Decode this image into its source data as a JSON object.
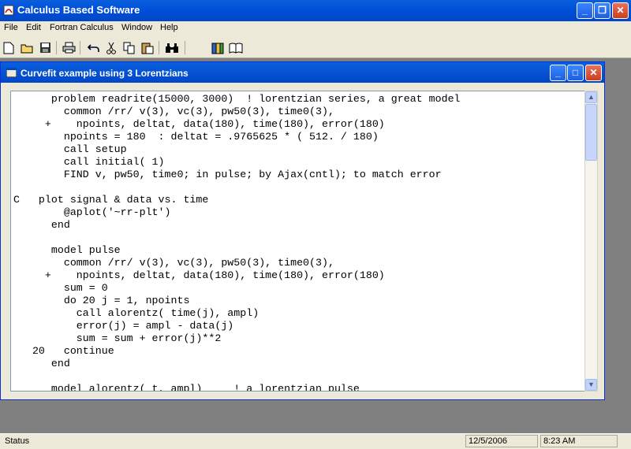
{
  "app": {
    "title": "Calculus Based Software",
    "icon": "app-logo-icon"
  },
  "menu": {
    "items": [
      "File",
      "Edit",
      "Fortran Calculus",
      "Window",
      "Help"
    ]
  },
  "toolbar": {
    "buttons": [
      {
        "icon": "new-document-icon"
      },
      {
        "icon": "open-folder-icon"
      },
      {
        "icon": "save-icon"
      },
      {
        "icon": "print-icon"
      },
      {
        "icon": "undo-icon"
      },
      {
        "icon": "cut-icon"
      },
      {
        "icon": "copy-icon"
      },
      {
        "icon": "paste-icon"
      },
      {
        "icon": "find-binoculars-icon"
      },
      {
        "icon": "book-icon"
      },
      {
        "icon": "help-book-icon"
      }
    ]
  },
  "child_window": {
    "title": "Curvefit example using 3 Lorentzians",
    "code": "      problem readrite(15000, 3000)  ! lorentzian series, a great model\n        common /rr/ v(3), vc(3), pw50(3), time0(3),\n     +    npoints, deltat, data(180), time(180), error(180)\n        npoints = 180  : deltat = .9765625 * ( 512. / 180)\n        call setup\n        call initial( 1)\n        FIND v, pw50, time0; in pulse; by Ajax(cntl); to match error\n\nC   plot signal & data vs. time\n        @aplot('~rr-plt')\n      end\n\n      model pulse\n        common /rr/ v(3), vc(3), pw50(3), time0(3),\n     +    npoints, deltat, data(180), time(180), error(180)\n        sum = 0\n        do 20 j = 1, npoints\n          call alorentz( time(j), ampl)\n          error(j) = ampl - data(j)\n          sum = sum + error(j)**2\n   20   continue\n      end\n\n      model alorentz( t, ampl)     ! a lorentzian pulse"
  },
  "status": {
    "text": "Status",
    "date": "12/5/2006",
    "time": "8:23 AM"
  },
  "colors": {
    "titlebar": "#0054e3",
    "face": "#ece9d8",
    "mdi_background": "#808080"
  }
}
